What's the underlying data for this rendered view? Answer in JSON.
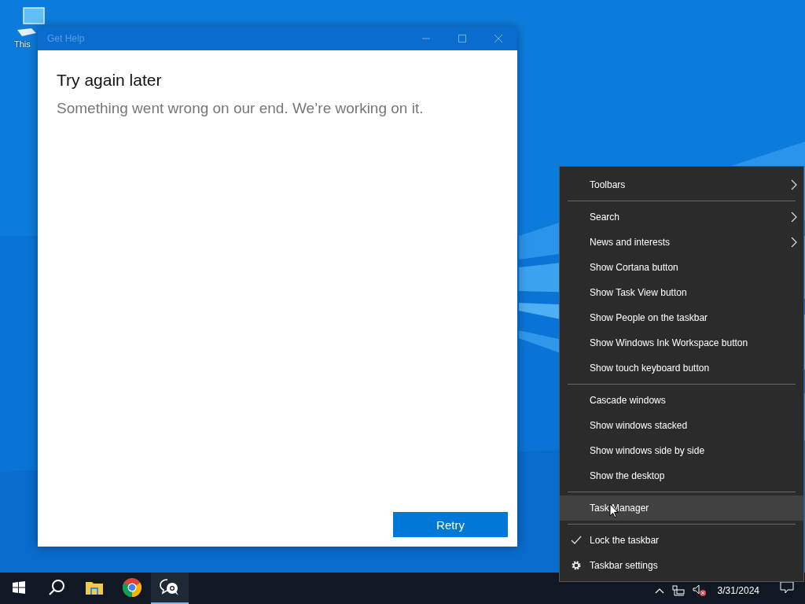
{
  "desktop": {
    "icons": [
      {
        "label": "This"
      }
    ]
  },
  "window": {
    "title": "Get Help",
    "heading": "Try again later",
    "message": "Something went wrong on our end. We’re working on it.",
    "button": "Retry"
  },
  "context_menu": {
    "items": [
      {
        "kind": "submenu",
        "label": "Toolbars",
        "selected": false
      },
      {
        "kind": "separator"
      },
      {
        "kind": "submenu",
        "label": "Search",
        "selected": false
      },
      {
        "kind": "submenu",
        "label": "News and interests",
        "selected": false
      },
      {
        "kind": "item",
        "label": "Show Cortana button",
        "selected": false
      },
      {
        "kind": "item",
        "label": "Show Task View button",
        "selected": false
      },
      {
        "kind": "item",
        "label": "Show People on the taskbar",
        "selected": false
      },
      {
        "kind": "item",
        "label": "Show Windows Ink Workspace button",
        "selected": false
      },
      {
        "kind": "item",
        "label": "Show touch keyboard button",
        "selected": false
      },
      {
        "kind": "separator"
      },
      {
        "kind": "item",
        "label": "Cascade windows",
        "selected": false
      },
      {
        "kind": "item",
        "label": "Show windows stacked",
        "selected": false
      },
      {
        "kind": "item",
        "label": "Show windows side by side",
        "selected": false
      },
      {
        "kind": "item",
        "label": "Show the desktop",
        "selected": false
      },
      {
        "kind": "separator"
      },
      {
        "kind": "item",
        "label": "Task Manager",
        "selected": true
      },
      {
        "kind": "separator"
      },
      {
        "kind": "toggle",
        "label": "Lock the taskbar",
        "selected": false,
        "checked": true
      },
      {
        "kind": "settings",
        "label": "Taskbar settings",
        "selected": false
      }
    ]
  },
  "taskbar": {
    "apps": [
      {
        "kind": "start",
        "active": false
      },
      {
        "kind": "search",
        "active": false
      },
      {
        "kind": "folder",
        "active": false
      },
      {
        "kind": "browser",
        "active": false
      },
      {
        "kind": "help",
        "active": true
      }
    ],
    "date": "3/31/2024"
  }
}
